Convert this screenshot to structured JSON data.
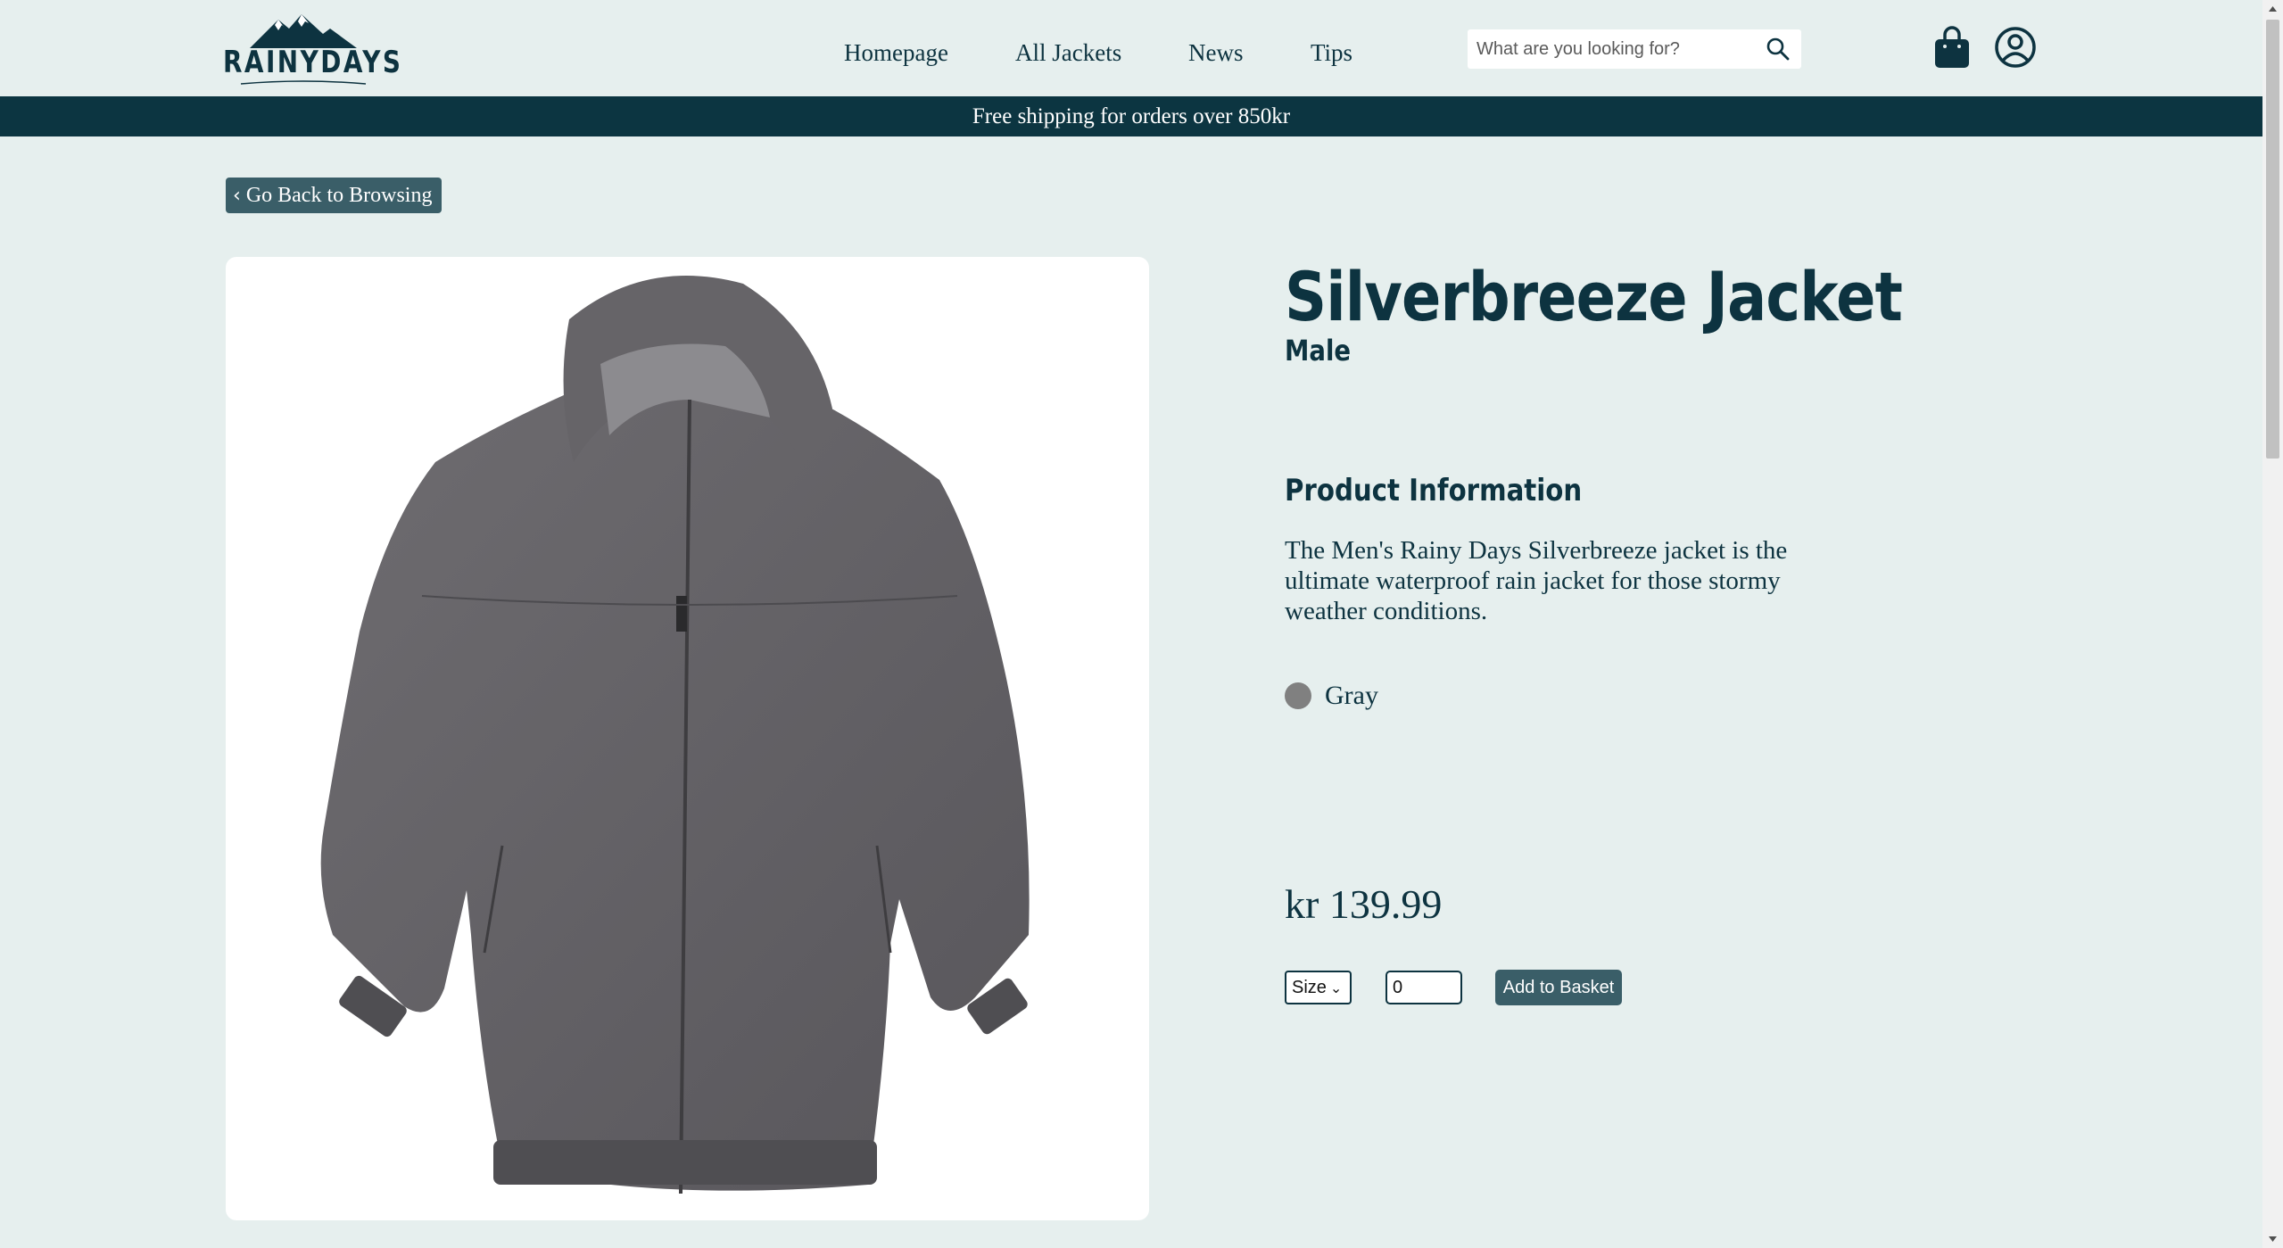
{
  "header": {
    "logo_text": "RAINYDAYS",
    "nav": [
      {
        "label": "Homepage"
      },
      {
        "label": "All Jackets"
      },
      {
        "label": "News"
      },
      {
        "label": "Tips"
      }
    ],
    "search": {
      "placeholder": "What are you looking for?",
      "value": ""
    },
    "icons": {
      "search": "search-icon",
      "cart": "shopping-bag-icon",
      "account": "user-circle-icon"
    }
  },
  "banner": {
    "text": "Free shipping for orders over 850kr"
  },
  "back_button": {
    "label": "Go Back to Browsing",
    "icon": "chevron-left-icon"
  },
  "product": {
    "image_alt": "Gray jacket",
    "title": "Silverbreeze Jacket",
    "gender": "Male",
    "info_heading": "Product Information",
    "description": "The Men's Rainy Days Silverbreeze jacket is the ultimate waterproof rain jacket for those stormy weather conditions.",
    "color": {
      "name": "Gray",
      "hex": "#808080"
    },
    "price": "kr 139.99",
    "size_select": {
      "selected": "Size"
    },
    "quantity": "0",
    "add_button": "Add to Basket"
  },
  "colors": {
    "background": "#e6efee",
    "primary_text": "#0d3340",
    "banner": "#0c3541",
    "button": "#3a5e68"
  }
}
